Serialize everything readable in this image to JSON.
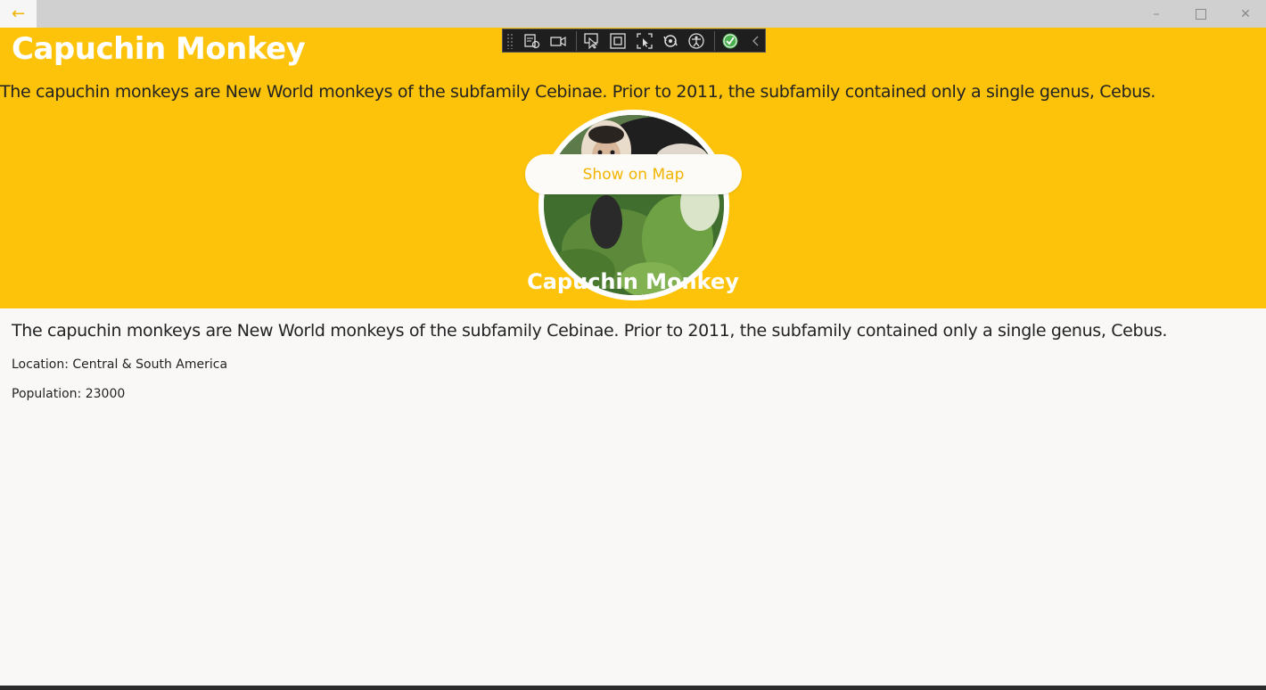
{
  "window": {
    "back_icon": "arrow-left-icon",
    "minimize_icon": "minimize-icon",
    "maximize_icon": "maximize-icon",
    "close_icon": "close-icon"
  },
  "header": {
    "title": "Capuchin Monkey",
    "description": "The capuchin monkeys are New World monkeys of the subfamily Cebinae. Prior to 2011, the subfamily contained only a single genus, Cebus.",
    "map_button_label": "Show on Map",
    "subtitle": "Capuchin Monkey"
  },
  "debug_toolbar": {
    "icons": [
      "grip-icon",
      "live-visual-tree-icon",
      "record-icon",
      "select-element-icon",
      "display-layout-adorners-icon",
      "track-focus-icon",
      "hot-reload-icon",
      "accessibility-icon",
      "binding-check-icon",
      "collapse-chevron-icon"
    ]
  },
  "details": {
    "description": "The capuchin monkeys are New World monkeys of the subfamily Cebinae. Prior to 2011, the subfamily contained only a single genus, Cebus.",
    "location": "Location: Central & South America",
    "population": "Population: 23000"
  },
  "colors": {
    "header_background": "#fcc30a",
    "accent": "#f2b400",
    "page_background": "#f9f8f7"
  }
}
